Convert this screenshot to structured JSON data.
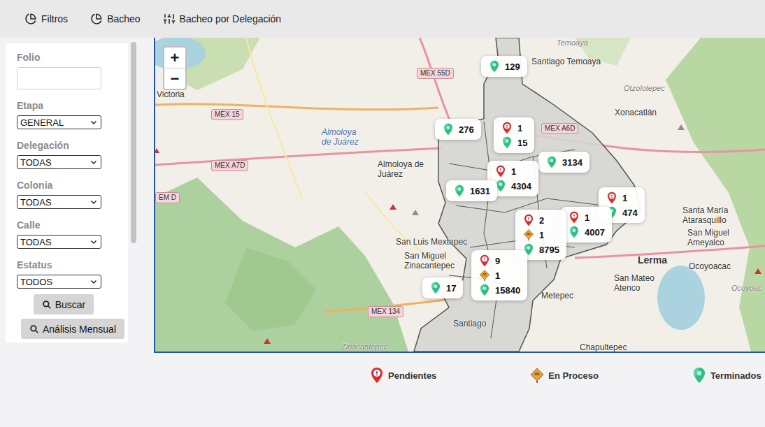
{
  "toolbar": {
    "tabs": [
      {
        "label": "Filtros",
        "icon": "pie"
      },
      {
        "label": "Bacheo",
        "icon": "pie"
      },
      {
        "label": "Bacheo por Delegación",
        "icon": "sliders"
      }
    ]
  },
  "sidebar": {
    "fields": [
      {
        "label": "Folio",
        "kind": "input",
        "value": ""
      },
      {
        "label": "Etapa",
        "kind": "select",
        "value": "GENERAL"
      },
      {
        "label": "Delegación",
        "kind": "select",
        "value": "TODAS"
      },
      {
        "label": "Colonia",
        "kind": "select",
        "value": "TODAS"
      },
      {
        "label": "Calle",
        "kind": "select",
        "value": "TODAS"
      },
      {
        "label": "Estatus",
        "kind": "select",
        "value": "TODOS"
      }
    ],
    "buttons": [
      "Buscar",
      "Análisis Mensual"
    ]
  },
  "map": {
    "zoom": [
      "+",
      "−"
    ],
    "labels": [
      {
        "text": "Temoaya",
        "kind": "italic"
      },
      {
        "text": "Santiago Temoaya",
        "kind": "town"
      },
      {
        "text": "Otzolotepec",
        "kind": "italic"
      },
      {
        "text": "Xonacatlán",
        "kind": "town"
      },
      {
        "text": "MEX 55D",
        "kind": "road"
      },
      {
        "text": "MEX 15",
        "kind": "road"
      },
      {
        "text": "MEX A7D",
        "kind": "road"
      },
      {
        "text": "MEX A6D",
        "kind": "road"
      },
      {
        "text": "EM D",
        "kind": "road"
      },
      {
        "text": "MEX 134",
        "kind": "road"
      },
      {
        "text": "Victoria",
        "kind": "town"
      },
      {
        "text": "Almoloya de Juárez",
        "kind": "water"
      },
      {
        "text": "Almoloya de Juárez",
        "kind": "town"
      },
      {
        "text": "San Luis Mextepec",
        "kind": "town"
      },
      {
        "text": "San Miguel Zinacantepec",
        "kind": "town"
      },
      {
        "text": "Metepec",
        "kind": "town"
      },
      {
        "text": "Lerma",
        "kind": "city"
      },
      {
        "text": "Santa María Atarasquillo",
        "kind": "town"
      },
      {
        "text": "San Miguel Ameyalco",
        "kind": "town"
      },
      {
        "text": "Ocoyoacac",
        "kind": "town"
      },
      {
        "text": "Ocoyoac",
        "kind": "italic"
      },
      {
        "text": "San Mateo Atenco",
        "kind": "town"
      },
      {
        "text": "Chapultepec",
        "kind": "town"
      },
      {
        "text": "Santiago",
        "kind": "town"
      },
      {
        "text": "Zinacantepec",
        "kind": "italic"
      }
    ],
    "clusters": [
      {
        "items": [
          {
            "kind": "terminado",
            "count": "129"
          }
        ]
      },
      {
        "items": [
          {
            "kind": "terminado",
            "count": "276"
          }
        ]
      },
      {
        "items": [
          {
            "kind": "pendiente",
            "count": "1"
          },
          {
            "kind": "terminado",
            "count": "15"
          }
        ]
      },
      {
        "items": [
          {
            "kind": "terminado",
            "count": "3134"
          }
        ]
      },
      {
        "items": [
          {
            "kind": "pendiente",
            "count": "1"
          },
          {
            "kind": "terminado",
            "count": "4304"
          }
        ]
      },
      {
        "items": [
          {
            "kind": "terminado",
            "count": "1631"
          }
        ]
      },
      {
        "items": [
          {
            "kind": "pendiente",
            "count": "1"
          },
          {
            "kind": "terminado",
            "count": "474"
          }
        ]
      },
      {
        "items": [
          {
            "kind": "pendiente",
            "count": "1"
          },
          {
            "kind": "terminado",
            "count": "4007"
          }
        ]
      },
      {
        "items": [
          {
            "kind": "pendiente",
            "count": "2"
          },
          {
            "kind": "proceso",
            "count": "1"
          },
          {
            "kind": "terminado",
            "count": "8795"
          }
        ]
      },
      {
        "items": [
          {
            "kind": "pendiente",
            "count": "9"
          },
          {
            "kind": "proceso",
            "count": "1"
          },
          {
            "kind": "terminado",
            "count": "15840"
          }
        ]
      },
      {
        "items": [
          {
            "kind": "terminado",
            "count": "17"
          }
        ]
      }
    ]
  },
  "legend": [
    {
      "kind": "pendiente",
      "label": "Pendientes"
    },
    {
      "kind": "proceso",
      "label": "En Proceso"
    },
    {
      "kind": "terminado",
      "label": "Terminados"
    }
  ]
}
